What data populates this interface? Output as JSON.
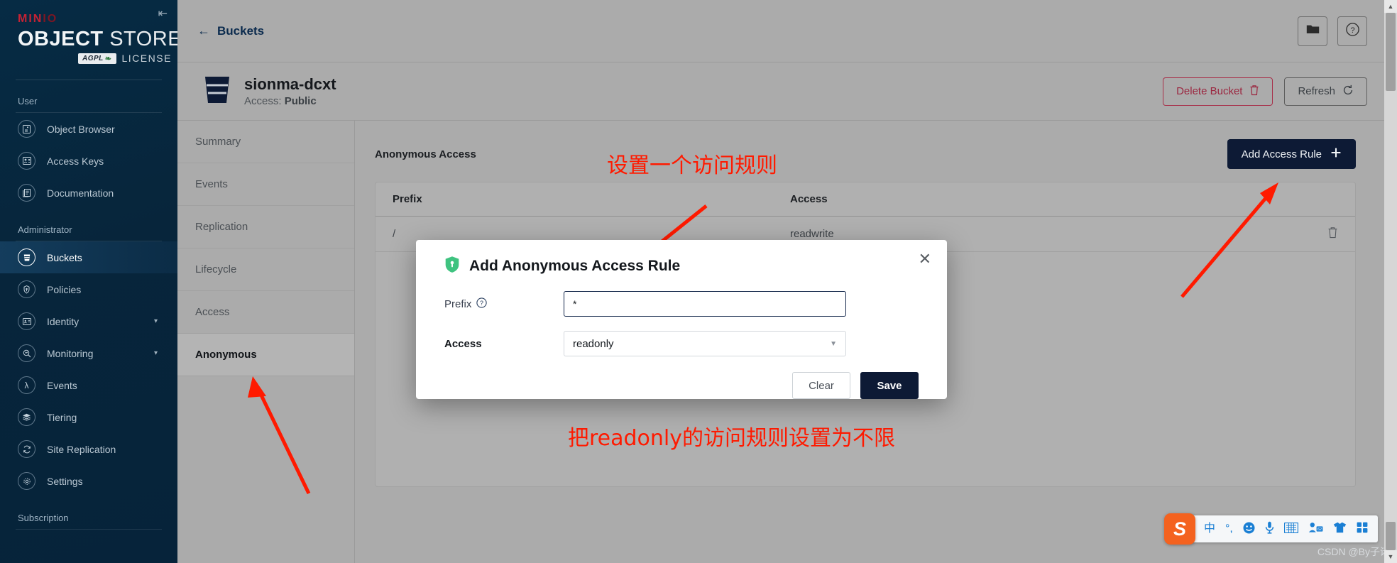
{
  "brand": {
    "minio": "MIN",
    "minio_suffix": "IO",
    "object": "OBJECT",
    "store": "STORE",
    "agpl": "AGPL",
    "license": "LICENSE",
    "collapse_icon": "collapse-sidebar-icon"
  },
  "sidebar": {
    "groups": [
      {
        "label": "User",
        "items": [
          {
            "label": "Object Browser",
            "icon": "object-browser-icon",
            "active": false,
            "expandable": false
          },
          {
            "label": "Access Keys",
            "icon": "access-keys-icon",
            "active": false,
            "expandable": false
          },
          {
            "label": "Documentation",
            "icon": "documentation-icon",
            "active": false,
            "expandable": false
          }
        ]
      },
      {
        "label": "Administrator",
        "items": [
          {
            "label": "Buckets",
            "icon": "buckets-icon",
            "active": true,
            "expandable": false
          },
          {
            "label": "Policies",
            "icon": "policies-icon",
            "active": false,
            "expandable": false
          },
          {
            "label": "Identity",
            "icon": "identity-icon",
            "active": false,
            "expandable": true
          },
          {
            "label": "Monitoring",
            "icon": "monitoring-icon",
            "active": false,
            "expandable": true
          },
          {
            "label": "Events",
            "icon": "events-lambda-icon",
            "active": false,
            "expandable": false
          },
          {
            "label": "Tiering",
            "icon": "tiering-icon",
            "active": false,
            "expandable": false
          },
          {
            "label": "Site Replication",
            "icon": "site-replication-icon",
            "active": false,
            "expandable": false
          },
          {
            "label": "Settings",
            "icon": "settings-gear-icon",
            "active": false,
            "expandable": false
          }
        ]
      },
      {
        "label": "Subscription",
        "items": []
      }
    ]
  },
  "topbar": {
    "back_label": "Buckets",
    "back_icon": "arrow-left-icon",
    "folder_button_icon": "folder-icon",
    "help_button_icon": "help-circle-icon"
  },
  "bucket": {
    "name": "sionma-dcxt",
    "access_prefix": "Access:",
    "access_value": "Public",
    "icon": "bucket-icon",
    "delete_label": "Delete Bucket",
    "delete_icon": "trash-icon",
    "refresh_label": "Refresh",
    "refresh_icon": "refresh-icon"
  },
  "tabs": [
    {
      "label": "Summary",
      "active": false
    },
    {
      "label": "Events",
      "active": false
    },
    {
      "label": "Replication",
      "active": false
    },
    {
      "label": "Lifecycle",
      "active": false
    },
    {
      "label": "Access",
      "active": false
    },
    {
      "label": "Anonymous",
      "active": true
    }
  ],
  "panel": {
    "title": "Anonymous Access",
    "add_rule_label": "Add Access Rule",
    "add_rule_icon": "plus-icon",
    "table": {
      "columns": [
        "Prefix",
        "Access"
      ],
      "rows": [
        {
          "prefix": "/",
          "access": "readwrite",
          "delete_icon": "trash-icon"
        }
      ]
    }
  },
  "modal": {
    "title": "Add Anonymous Access Rule",
    "shield_icon": "shield-lock-icon",
    "close_icon": "close-icon",
    "prefix_label": "Prefix",
    "prefix_help_icon": "help-circle-icon",
    "prefix_value": "*",
    "access_label": "Access",
    "access_value": "readonly",
    "access_caret_icon": "chevron-down-icon",
    "clear_label": "Clear",
    "save_label": "Save"
  },
  "annotations": {
    "top": "设置一个访问规则",
    "bottom": "把readonly的访问规则设置为不限",
    "color": "#ff1a00"
  },
  "ime": {
    "logo": "S",
    "items": [
      {
        "glyph": "中",
        "name": "language-mode-icon"
      },
      {
        "glyph": "°,",
        "name": "punctuation-mode-icon"
      },
      {
        "glyph": "☺",
        "name": "emoji-icon"
      },
      {
        "glyph": "🎤",
        "name": "voice-input-icon"
      },
      {
        "glyph": "⌨",
        "name": "soft-keyboard-icon"
      },
      {
        "glyph": "👤",
        "name": "user-account-icon",
        "badge": "62"
      },
      {
        "glyph": "👕",
        "name": "skin-theme-icon"
      },
      {
        "glyph": "▣",
        "name": "toolbox-icon"
      }
    ]
  },
  "watermark": "CSDN @By子诺",
  "scrollbar": {
    "up_icon": "scroll-up-arrow-icon",
    "down_icon": "scroll-down-arrow-icon"
  }
}
